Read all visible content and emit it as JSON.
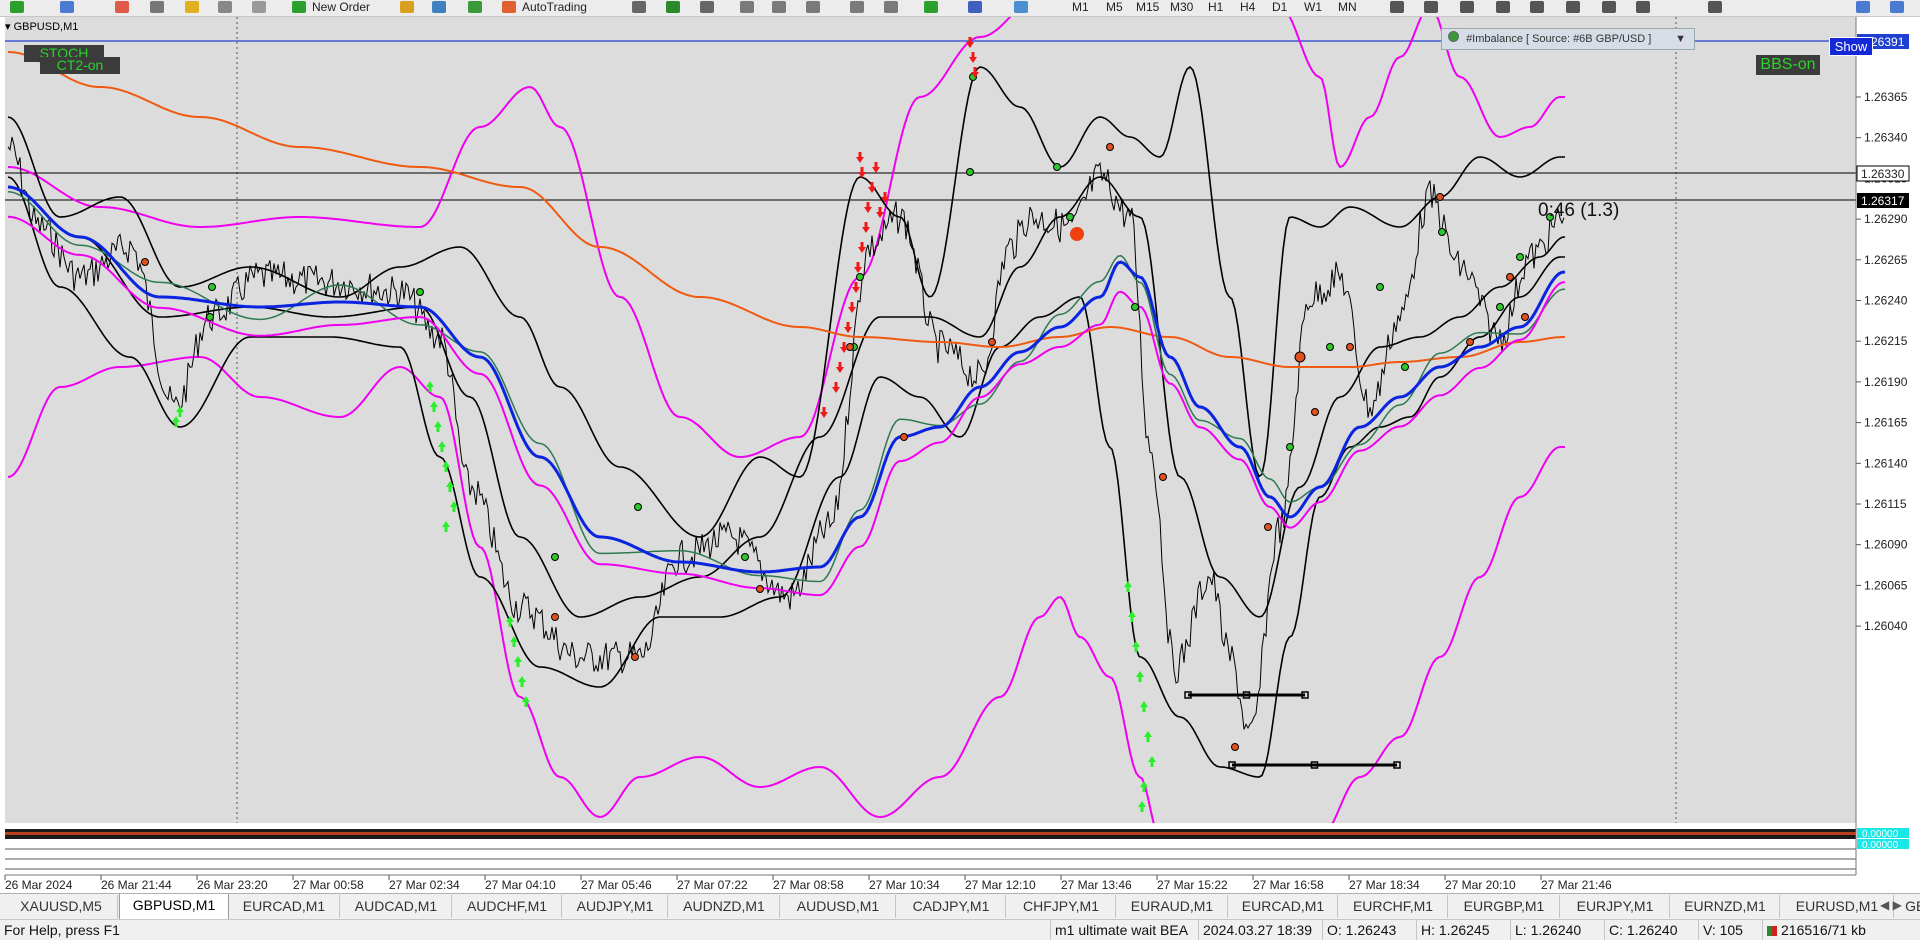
{
  "toolbar": {
    "new_order": "New Order",
    "autotrading": "AutoTrading",
    "timeframes": [
      "M1",
      "M5",
      "M15",
      "M30",
      "H1",
      "H4",
      "D1",
      "W1",
      "MN"
    ]
  },
  "chart": {
    "symbol_tag": "GBPUSD,M1",
    "stoch_label": "STOCH",
    "ct2_label": "CT2-on",
    "bbs_label": "BBS-on",
    "show_label": "Show",
    "imbalance_label": "#Imbalance [ Source: #6B GBP/USD ]",
    "ratio_label": "0:46 (1.3)",
    "price_ticks": [
      "1.26365",
      "1.26340",
      "1.26315",
      "1.26290",
      "1.26265",
      "1.26240",
      "1.26215",
      "1.26190",
      "1.26165",
      "1.26140",
      "1.26115",
      "1.26090",
      "1.26065",
      "1.26040"
    ],
    "price_tag_top": "1.26391",
    "price_tag_mid": "1.26330",
    "price_tag_bid": "1.26317",
    "osc_tag_1": "0.00000",
    "osc_tag_2": "0.00000",
    "time_ticks": [
      "26 Mar 2024",
      "26 Mar 21:44",
      "26 Mar 23:20",
      "27 Mar 00:58",
      "27 Mar 02:34",
      "27 Mar 04:10",
      "27 Mar 05:46",
      "27 Mar 07:22",
      "27 Mar 08:58",
      "27 Mar 10:34",
      "27 Mar 12:10",
      "27 Mar 13:46",
      "27 Mar 15:22",
      "27 Mar 16:58",
      "27 Mar 18:34",
      "27 Mar 20:10",
      "27 Mar 21:46"
    ],
    "colors": {
      "background": "#dcdcdc",
      "price": "#000000",
      "ma_blue": "#0a24e0",
      "ma_green": "#2d7a50",
      "ma_orange": "#f05a10",
      "bands_magenta": "#f000f0",
      "buy_arrow": "#28f028",
      "sell_arrow": "#f01818",
      "bid_tag": "#000000",
      "show_button": "#1428d8",
      "badge_text": "#2bd32b"
    }
  },
  "tabs": [
    "XAUUSD,M5",
    "GBPUSD,M1",
    "EURCAD,M1",
    "AUDCAD,M1",
    "AUDCHF,M1",
    "AUDJPY,M1",
    "AUDNZD,M1",
    "AUDUSD,M1",
    "CADJPY,M1",
    "CHFJPY,M1",
    "EURAUD,M1",
    "EURCAD,M1",
    "EURCHF,M1",
    "EURGBP,M1",
    "EURJPY,M1",
    "EURNZD,M1",
    "EURUSD,M1",
    "GBPA"
  ],
  "active_tab": "GBPUSD,M1",
  "status": {
    "help": "For Help, press F1",
    "profile": "m1 ultimate wait BEA",
    "datetime": "2024.03.27 18:39",
    "open": "O: 1.26243",
    "high": "H: 1.26245",
    "low": "L: 1.26240",
    "close": "C: 1.26240",
    "volume": "V: 105",
    "traffic": "216516/71 kb"
  }
}
